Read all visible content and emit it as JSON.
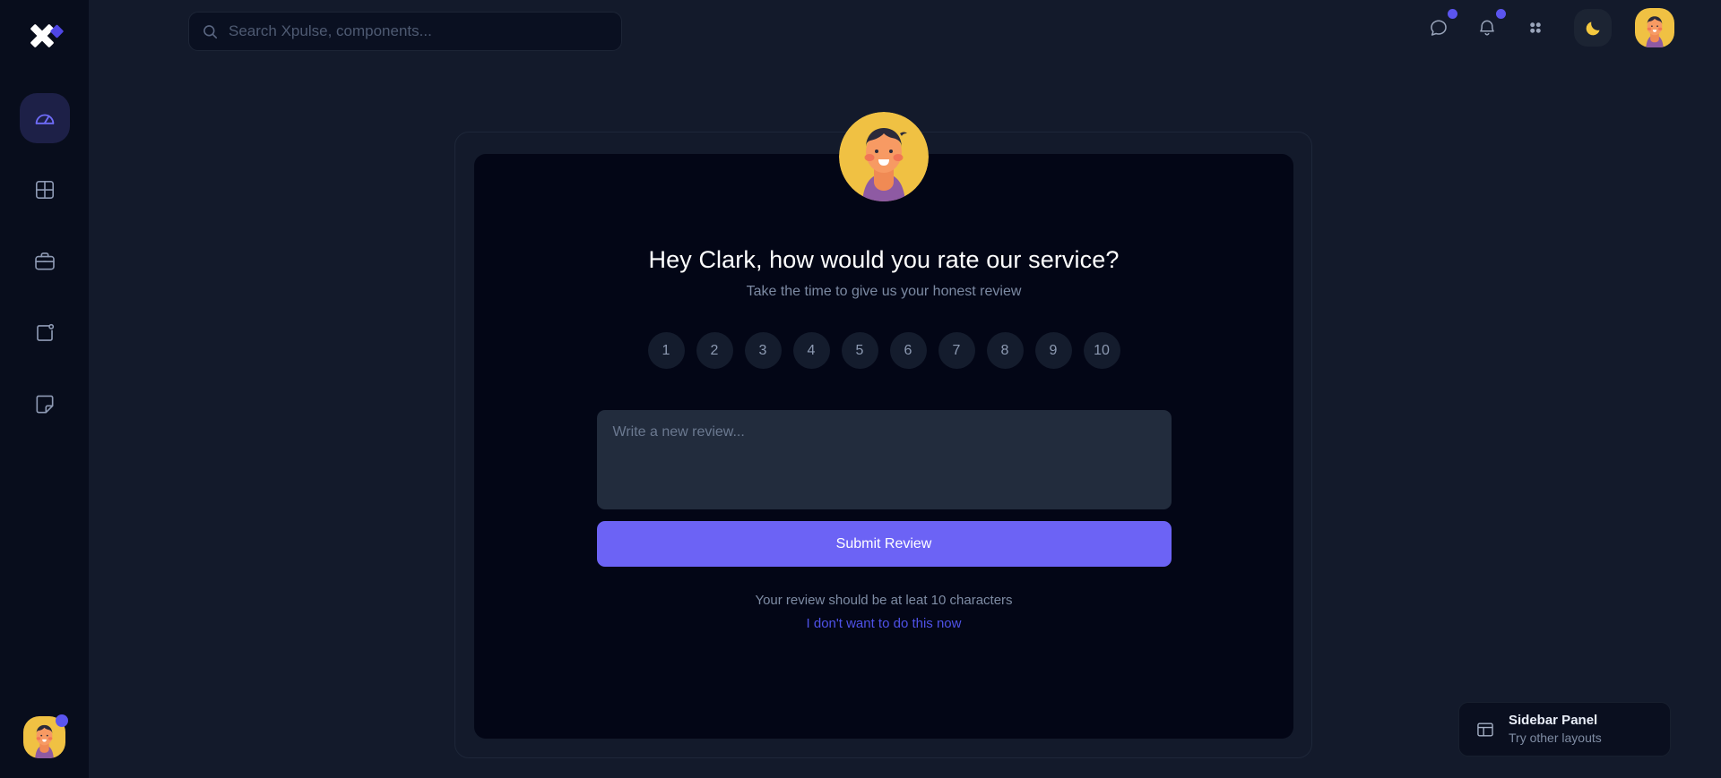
{
  "app": {
    "logo_name": "xpulse-logo"
  },
  "sidebar": {
    "items": [
      {
        "name": "dashboard",
        "icon": "gauge-icon",
        "active": true
      },
      {
        "name": "grid",
        "icon": "grid-icon",
        "active": false
      },
      {
        "name": "briefcase",
        "icon": "briefcase-icon",
        "active": false
      },
      {
        "name": "square-dot",
        "icon": "square-dot-icon",
        "active": false
      },
      {
        "name": "sticker",
        "icon": "sticker-icon",
        "active": false
      }
    ],
    "avatar_alt": "user-avatar"
  },
  "search": {
    "placeholder": "Search Xpulse, components...",
    "value": "",
    "icon": "search-icon"
  },
  "header": {
    "chat_icon": "chat-bubble-icon",
    "chat_badge": true,
    "bell_icon": "bell-icon",
    "bell_badge": true,
    "apps_icon": "apps-grid-icon",
    "theme_icon": "moon-icon",
    "avatar_alt": "profile-avatar"
  },
  "card": {
    "title": "Hey Clark, how would you rate our service?",
    "subtitle": "Take the time to give us your honest review",
    "ratings": [
      "1",
      "2",
      "3",
      "4",
      "5",
      "6",
      "7",
      "8",
      "9",
      "10"
    ],
    "review_placeholder": "Write a new review...",
    "review_value": "",
    "submit_label": "Submit Review",
    "hint": "Your review should be at leat 10 characters",
    "skip_label": "I don't want to do this now"
  },
  "panel_toast": {
    "icon": "layout-panel-icon",
    "title": "Sidebar Panel",
    "subtitle": "Try other layouts"
  },
  "colors": {
    "accent": "#6c63f5",
    "badge": "#5b55ef",
    "link": "#4f52e8",
    "page_bg": "#131a2b",
    "sidebar_bg": "#080d1c",
    "card_bg": "#030616",
    "input_bg": "#222c3d",
    "avatar_bg": "#f0c143"
  }
}
